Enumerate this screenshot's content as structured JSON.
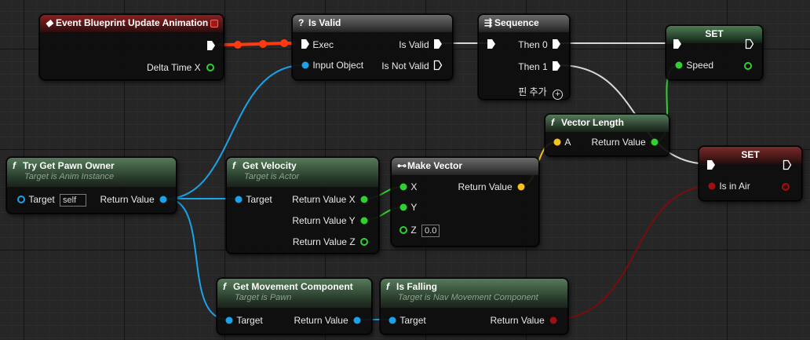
{
  "colors": {
    "exec": "#ffffff",
    "object": "#1aa3e8",
    "float": "#2fd12f",
    "vector": "#f5c021",
    "bool": "#a01010",
    "exec_active": "#ff3a10"
  },
  "nodes": {
    "event_update": {
      "title": "Event Blueprint Update Animation",
      "icon": "event-icon",
      "delta": "Delta Time X"
    },
    "is_valid": {
      "icon_text": "?",
      "title": "Is Valid",
      "exec": "Exec",
      "input_object": "Input Object",
      "is_valid_out": "Is Valid",
      "is_not_valid_out": "Is Not Valid"
    },
    "sequence": {
      "title": "Sequence",
      "then0": "Then 0",
      "then1": "Then 1",
      "add_pin": "핀 추가"
    },
    "set_speed": {
      "title": "SET",
      "speed": "Speed"
    },
    "vector_length": {
      "icon_text": "f",
      "title": "Vector Length",
      "a": "A",
      "return": "Return Value"
    },
    "set_in_air": {
      "title": "SET",
      "is_in_air": "Is in Air"
    },
    "try_get_pawn": {
      "icon_text": "f",
      "title": "Try Get Pawn Owner",
      "subtitle": "Target is Anim Instance",
      "target": "Target",
      "target_value": "self",
      "return": "Return Value"
    },
    "get_velocity": {
      "icon_text": "f",
      "title": "Get Velocity",
      "subtitle": "Target is Actor",
      "target": "Target",
      "rx": "Return Value X",
      "ry": "Return Value Y",
      "rz": "Return Value Z"
    },
    "make_vector": {
      "title": "Make Vector",
      "icon": "make-vector-icon",
      "x": "X",
      "y": "Y",
      "z": "Z",
      "z_value": "0.0",
      "return": "Return Value"
    },
    "get_movement": {
      "icon_text": "f",
      "title": "Get Movement Component",
      "subtitle": "Target is Pawn",
      "target": "Target",
      "return": "Return Value"
    },
    "is_falling": {
      "icon_text": "f",
      "title": "Is Falling",
      "subtitle": "Target is Nav Movement Component",
      "target": "Target",
      "return": "Return Value"
    }
  }
}
